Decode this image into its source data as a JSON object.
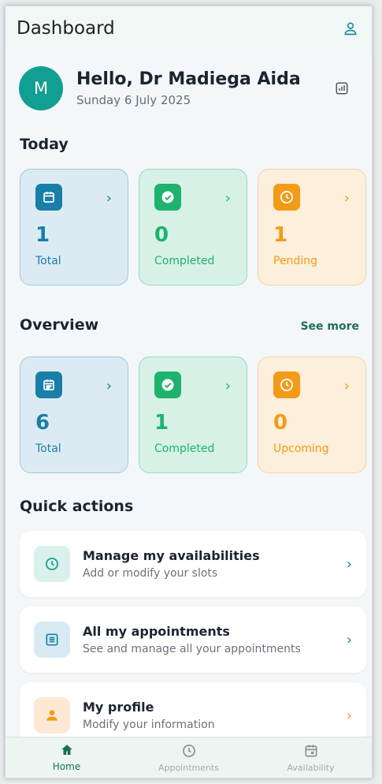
{
  "appbar": {
    "title": "Dashboard",
    "profile_icon": "person-icon"
  },
  "greeting": {
    "avatar_initial": "M",
    "name": "Hello, Dr Madiega Aida",
    "date": "Sunday 6 July 2025",
    "stats_icon": "bar-chart-icon"
  },
  "today": {
    "title": "Today",
    "cards": [
      {
        "value": "1",
        "label": "Total",
        "icon": "calendar-icon",
        "color": "#1a7fa8"
      },
      {
        "value": "0",
        "label": "Completed",
        "icon": "check-circle-icon",
        "color": "#1db36c"
      },
      {
        "value": "1",
        "label": "Pending",
        "icon": "clock-icon",
        "color": "#f39a16"
      }
    ]
  },
  "overview": {
    "title": "Overview",
    "see_more": "See more",
    "cards": [
      {
        "value": "6",
        "label": "Total",
        "icon": "calendar-month-icon",
        "color": "#1a7fa8"
      },
      {
        "value": "1",
        "label": "Completed",
        "icon": "check-circle-icon",
        "color": "#1db36c"
      },
      {
        "value": "0",
        "label": "Upcoming",
        "icon": "clock-icon",
        "color": "#f39a16"
      }
    ]
  },
  "quick_actions": {
    "title": "Quick actions",
    "items": [
      {
        "title": "Manage my availabilities",
        "subtitle": "Add or modify your slots",
        "icon": "clock-icon",
        "color": "#11988f"
      },
      {
        "title": "All my appointments",
        "subtitle": "See and manage all your appointments",
        "icon": "list-icon",
        "color": "#1a7fa8"
      },
      {
        "title": "My profile",
        "subtitle": "Modify your information",
        "icon": "person-icon",
        "color": "#f39a16"
      }
    ]
  },
  "nav": {
    "items": [
      {
        "label": "Home",
        "icon": "home-icon",
        "active": true
      },
      {
        "label": "Appointments",
        "icon": "clock-icon",
        "active": false
      },
      {
        "label": "Availability",
        "icon": "calendar-icon",
        "active": false
      }
    ]
  },
  "colors": {
    "accent": "#119e93",
    "blue": "#1a7fa8",
    "green": "#1db36c",
    "orange": "#f39a16"
  }
}
